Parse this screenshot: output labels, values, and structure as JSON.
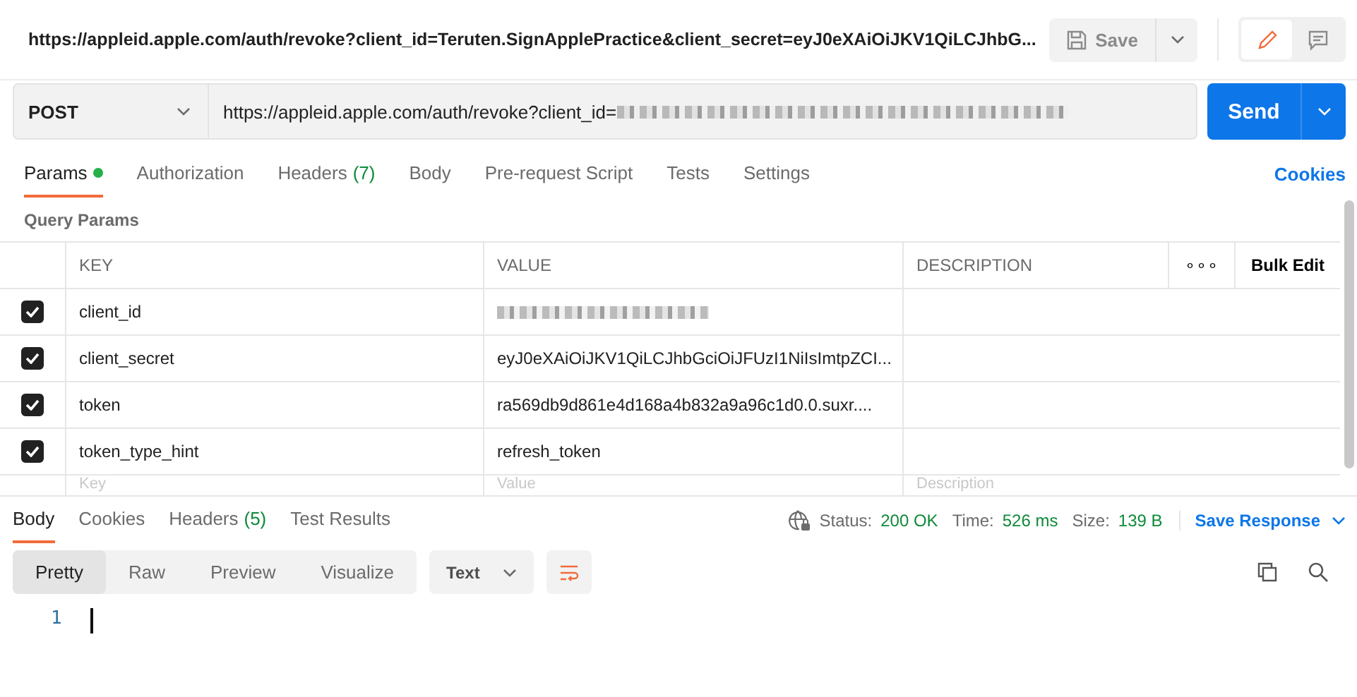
{
  "request_title": "https://appleid.apple.com/auth/revoke?client_id=Teruten.SignApplePractice&client_secret=eyJ0eXAiOiJKV1QiLCJhbG...",
  "title_bar": {
    "save": "Save",
    "modes": [
      {
        "kind": "edit",
        "selected": true
      },
      {
        "kind": "comment",
        "selected": false
      }
    ]
  },
  "request": {
    "method": "POST",
    "url": "https://appleid.apple.com/auth/revoke?client_id=",
    "send": "Send"
  },
  "tabs": [
    {
      "label": "Params",
      "selected": true,
      "indicator": true
    },
    {
      "label": "Authorization",
      "selected": false,
      "indicator": false
    },
    {
      "label": "Headers",
      "count": "(7)",
      "selected": false,
      "indicator": false
    },
    {
      "label": "Body",
      "selected": false,
      "indicator": false
    },
    {
      "label": "Pre-request Script",
      "selected": false,
      "indicator": false
    },
    {
      "label": "Tests",
      "selected": false,
      "indicator": false
    },
    {
      "label": "Settings",
      "selected": false,
      "indicator": false
    }
  ],
  "cookies_link": "Cookies",
  "query_params": {
    "title": "Query Params",
    "columns": [
      "KEY",
      "VALUE",
      "DESCRIPTION"
    ],
    "more": "∘∘∘",
    "bulk_edit": "Bulk Edit",
    "rows": [
      {
        "key": "client_id",
        "value": "",
        "redacted": true,
        "checked": true
      },
      {
        "key": "client_secret",
        "value": "eyJ0eXAiOiJKV1QiLCJhbGciOiJFUzI1NiIsImtpZCI...",
        "redacted": false,
        "checked": true
      },
      {
        "key": "token",
        "value": "ra569db9d861e4d168a4b832a9a96c1d0.0.suxr....",
        "redacted": false,
        "checked": true
      },
      {
        "key": "token_type_hint",
        "value": "refresh_token",
        "redacted": false,
        "checked": true
      }
    ],
    "new_row": {
      "key_placeholder": "Key",
      "value_placeholder": "Value",
      "description_placeholder": "Description"
    }
  },
  "response": {
    "tabs": [
      {
        "label": "Body",
        "selected": true
      },
      {
        "label": "Cookies",
        "selected": false
      },
      {
        "label": "Headers",
        "count": "(5)",
        "selected": false
      },
      {
        "label": "Test Results",
        "selected": false
      }
    ],
    "status_label": "Status:",
    "status": "200 OK",
    "time_label": "Time:",
    "time": "526 ms",
    "size_label": "Size:",
    "size": "139 B",
    "save_response": "Save Response",
    "views": [
      {
        "label": "Pretty",
        "selected": true
      },
      {
        "label": "Raw",
        "selected": false
      },
      {
        "label": "Preview",
        "selected": false
      },
      {
        "label": "Visualize",
        "selected": false
      }
    ],
    "format": "Text",
    "line_numbers": [
      "1"
    ]
  }
}
